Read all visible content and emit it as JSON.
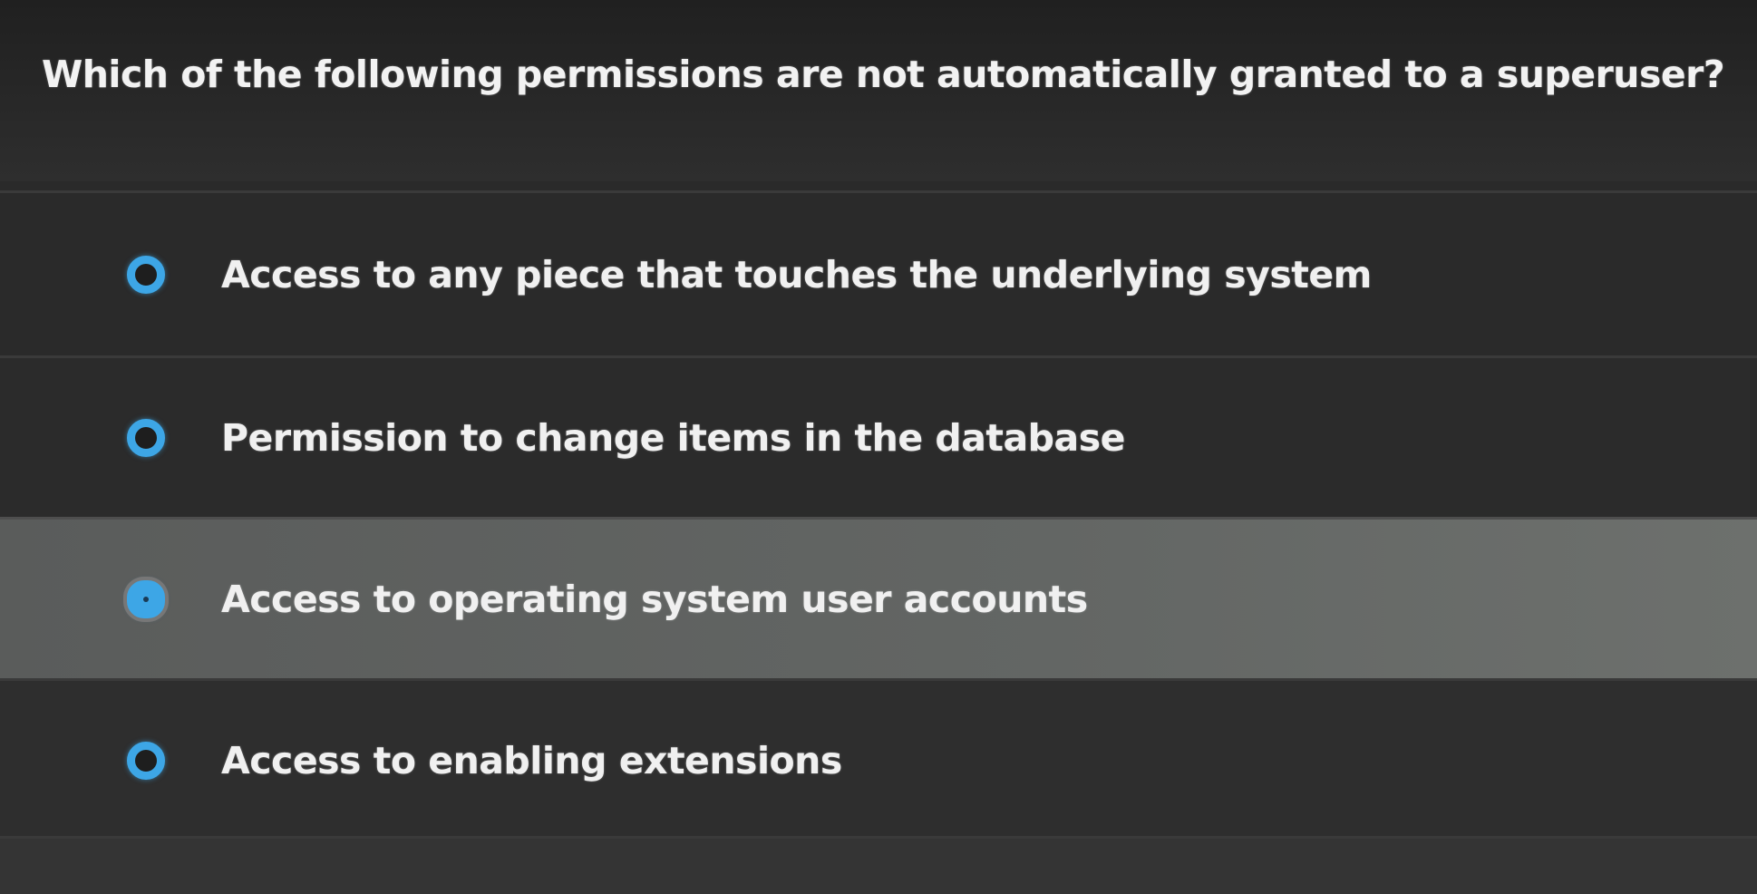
{
  "question": {
    "text": "Which of the following permissions are not automatically granted to a superuser?"
  },
  "options": [
    {
      "label": "Access to any piece that touches the underlying system",
      "selected": false
    },
    {
      "label": "Permission to change items in the database",
      "selected": false
    },
    {
      "label": "Access to operating system user accounts",
      "selected": true
    },
    {
      "label": "Access to enabling extensions",
      "selected": false
    }
  ],
  "colors": {
    "accent": "#3da6e6",
    "background": "#2b2b2b",
    "selected_row": "#636664",
    "text": "#f0f0f0"
  }
}
